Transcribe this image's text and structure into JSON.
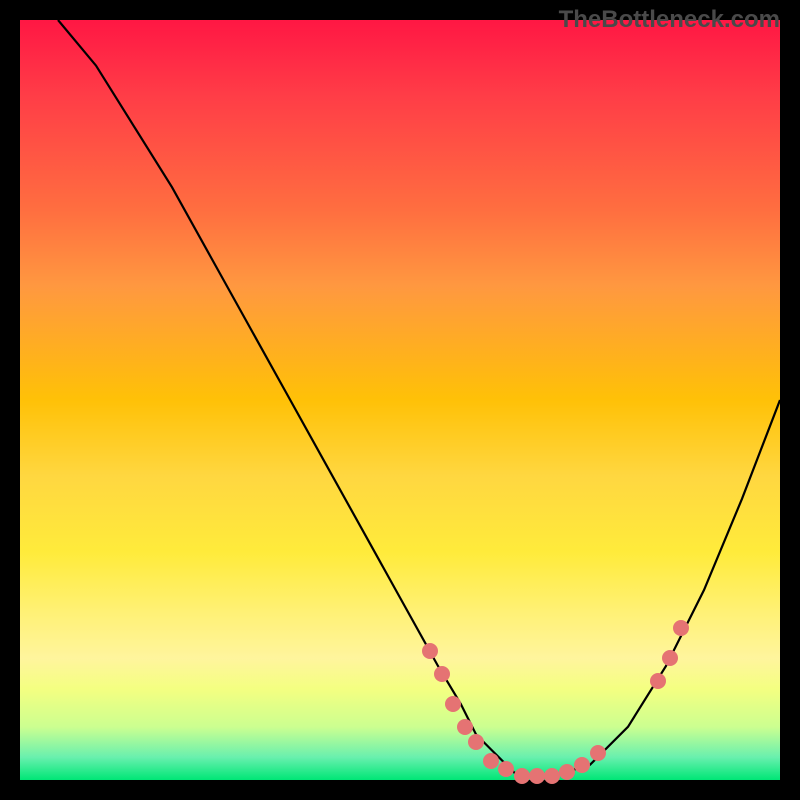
{
  "watermark": "TheBottleneck.com",
  "chart_data": {
    "type": "line",
    "title": "",
    "xlabel": "",
    "ylabel": "",
    "xlim": [
      0,
      100
    ],
    "ylim": [
      0,
      100
    ],
    "legend": false,
    "grid": false,
    "series": [
      {
        "name": "curve",
        "x": [
          5,
          10,
          15,
          20,
          25,
          30,
          35,
          40,
          45,
          50,
          55,
          58,
          60,
          62,
          65,
          68,
          70,
          75,
          80,
          85,
          90,
          95,
          100
        ],
        "y": [
          100,
          94,
          86,
          78,
          69,
          60,
          51,
          42,
          33,
          24,
          15,
          10,
          6,
          4,
          1,
          0,
          0.5,
          2,
          7,
          15,
          25,
          37,
          50
        ]
      }
    ],
    "highlighted_points": [
      {
        "x": 54,
        "y": 17
      },
      {
        "x": 55.5,
        "y": 14
      },
      {
        "x": 57,
        "y": 10
      },
      {
        "x": 58.5,
        "y": 7
      },
      {
        "x": 60,
        "y": 5
      },
      {
        "x": 62,
        "y": 2.5
      },
      {
        "x": 64,
        "y": 1.5
      },
      {
        "x": 66,
        "y": 0.5
      },
      {
        "x": 68,
        "y": 0.5
      },
      {
        "x": 70,
        "y": 0.5
      },
      {
        "x": 72,
        "y": 1
      },
      {
        "x": 74,
        "y": 2
      },
      {
        "x": 76,
        "y": 3.5
      },
      {
        "x": 84,
        "y": 13
      },
      {
        "x": 85.5,
        "y": 16
      },
      {
        "x": 87,
        "y": 20
      }
    ],
    "gradient_colors": {
      "top": "#ff1744",
      "middle": "#ffeb3b",
      "bottom": "#00e676"
    },
    "highlight_color": "#e57373",
    "curve_color": "#000000"
  }
}
